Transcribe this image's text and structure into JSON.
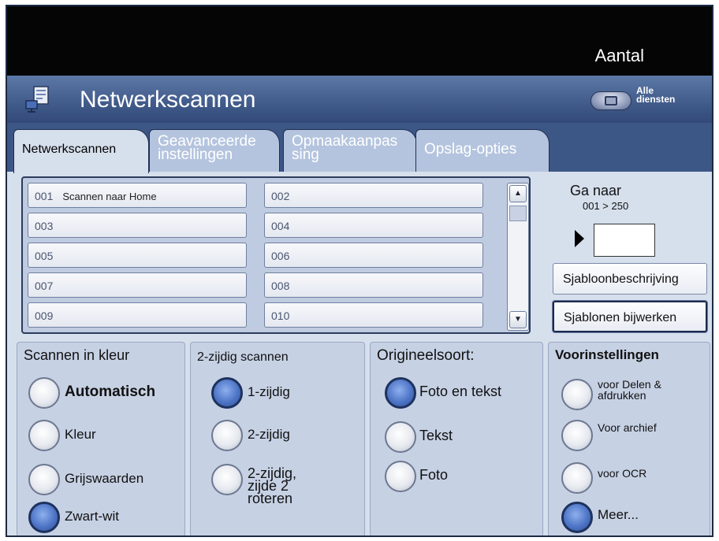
{
  "header": {
    "quantity_label": "Aantal"
  },
  "titlebar": {
    "title": "Netwerkscannen",
    "app_icon": "network-scan-icon",
    "services_label": "Alle\ndiensten",
    "services_icon": "all-services-icon"
  },
  "tabs": [
    {
      "label": "Netwerkscannen",
      "active": true
    },
    {
      "label": "Geavanceerde instellingen",
      "active": false
    },
    {
      "label": "Opmaakaanpas sing",
      "active": false
    },
    {
      "label": "Opslag-opties",
      "active": false
    }
  ],
  "templates": [
    {
      "num": "001",
      "name": "Scannen naar Home"
    },
    {
      "num": "002",
      "name": ""
    },
    {
      "num": "003",
      "name": ""
    },
    {
      "num": "004",
      "name": ""
    },
    {
      "num": "005",
      "name": ""
    },
    {
      "num": "006",
      "name": ""
    },
    {
      "num": "007",
      "name": ""
    },
    {
      "num": "008",
      "name": ""
    },
    {
      "num": "009",
      "name": ""
    },
    {
      "num": "010",
      "name": ""
    }
  ],
  "goto": {
    "label": "Ga naar",
    "range": "001 > 250",
    "value": ""
  },
  "side_buttons": {
    "description": "Sjabloonbeschrijving",
    "update": "Sjablonen bijwerken"
  },
  "groups": {
    "color": {
      "title": "Scannen in kleur",
      "options": [
        {
          "label": "Automatisch",
          "selected": false,
          "strong": true
        },
        {
          "label": "Kleur",
          "selected": false
        },
        {
          "label": "Grijswaarden",
          "selected": false
        },
        {
          "label": "Zwart-wit",
          "selected": true
        }
      ]
    },
    "duplex": {
      "title": "2-zijdig scannen",
      "options": [
        {
          "label": "1-zijdig",
          "selected": true
        },
        {
          "label": "2-zijdig",
          "selected": false
        },
        {
          "label": "2-zijdig,\nzijde 2\nroteren",
          "selected": false
        }
      ]
    },
    "original": {
      "title": "Origineelsoort:",
      "options": [
        {
          "label": "Foto en tekst",
          "selected": true
        },
        {
          "label": "Tekst",
          "selected": false
        },
        {
          "label": "Foto",
          "selected": false
        }
      ]
    },
    "presets": {
      "title": "Voorinstellingen",
      "options": [
        {
          "label": "voor Delen &\nafdrukken",
          "selected": false
        },
        {
          "label": "Voor archief",
          "selected": false
        },
        {
          "label": "voor OCR",
          "selected": false
        },
        {
          "label": "Meer...",
          "selected": true
        }
      ]
    }
  },
  "colors": {
    "title_bar": "#3c5685",
    "panel": "#d6dfec",
    "radio_on": "#4e75c6"
  }
}
